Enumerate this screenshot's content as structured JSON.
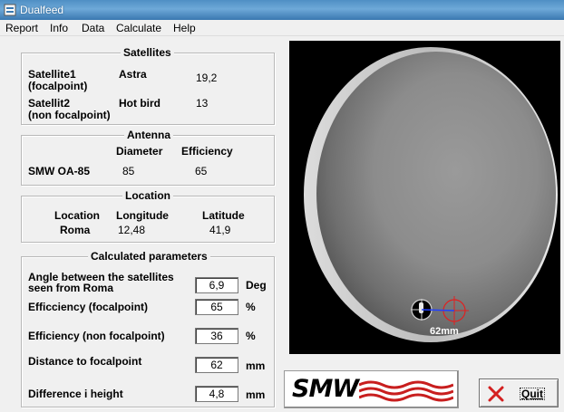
{
  "window": {
    "title": "Dualfeed"
  },
  "menu": [
    "Report",
    "Info",
    "Data",
    "Calculate",
    "Help"
  ],
  "satellites": {
    "title": "Satellites",
    "sat1": {
      "label_line1": "Satellite1",
      "label_line2": "(focalpoint)",
      "name": "Astra",
      "value": "19,2"
    },
    "sat2": {
      "label_line1": "Satellit2",
      "label_line2": "(non focalpoint)",
      "name": "Hot bird",
      "value": "13"
    }
  },
  "antenna": {
    "title": "Antenna",
    "col_diameter": "Diameter",
    "col_efficiency": "Efficiency",
    "model": "SMW OA-85",
    "diameter": "85",
    "efficiency": "65"
  },
  "location": {
    "title": "Location",
    "col_location": "Location",
    "col_longitude": "Longitude",
    "col_latitude": "Latitude",
    "name": "Roma",
    "longitude": "12,48",
    "latitude": "41,9"
  },
  "calculated": {
    "title": "Calculated parameters",
    "angle": {
      "label_line1": "Angle between the satellites",
      "label_line2": "seen from Roma",
      "value": "6,9",
      "unit": "Deg"
    },
    "eff_focal": {
      "label": "Efficciency  (focalpoint)",
      "value": "65",
      "unit": "%"
    },
    "eff_nonfocal": {
      "label": "Efficiency  (non focalpoint)",
      "value": "36",
      "unit": "%"
    },
    "distance": {
      "label": "Distance to focalpoint",
      "value": "62",
      "unit": "mm"
    },
    "height": {
      "label": "Difference i height",
      "value": "4,8",
      "unit": "mm"
    }
  },
  "dish": {
    "distance_label": "62mm"
  },
  "logo": {
    "text": "SMW"
  },
  "quit": {
    "label": "Quit"
  },
  "colors": {
    "title_bar": "#4f8fc4",
    "crosshair_red": "#e02020",
    "feed_blue": "#2040ff",
    "logo_wave_red": "#c81e1e",
    "quit_x_red": "#d42020"
  }
}
